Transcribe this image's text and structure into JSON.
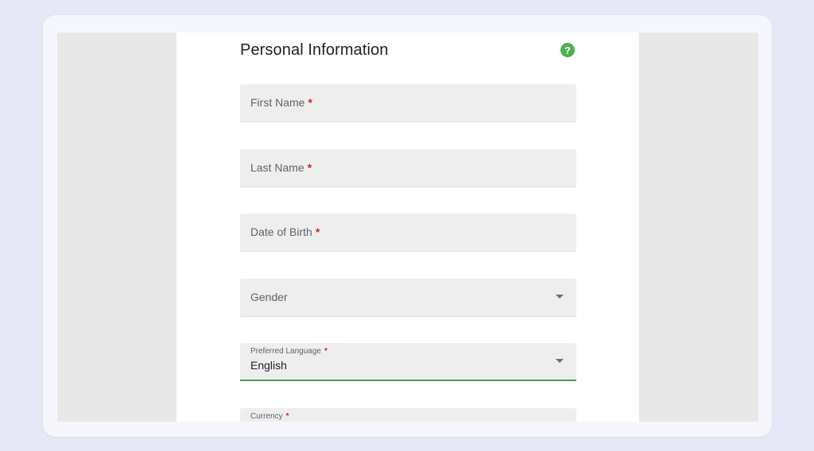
{
  "form": {
    "title": "Personal Information",
    "help_icon": "?",
    "required_marker": "*",
    "fields": [
      {
        "label": "First Name",
        "required": true
      },
      {
        "label": "Last Name",
        "required": true
      },
      {
        "label": "Date of Birth",
        "required": true
      },
      {
        "label": "Gender",
        "required": false
      },
      {
        "label": "Preferred Language",
        "required": true,
        "value": "English"
      },
      {
        "label": "Currency",
        "required": true
      }
    ]
  },
  "colors": {
    "accent": "#4caf50",
    "required": "#c62828",
    "focus_underline": "#43a047"
  }
}
